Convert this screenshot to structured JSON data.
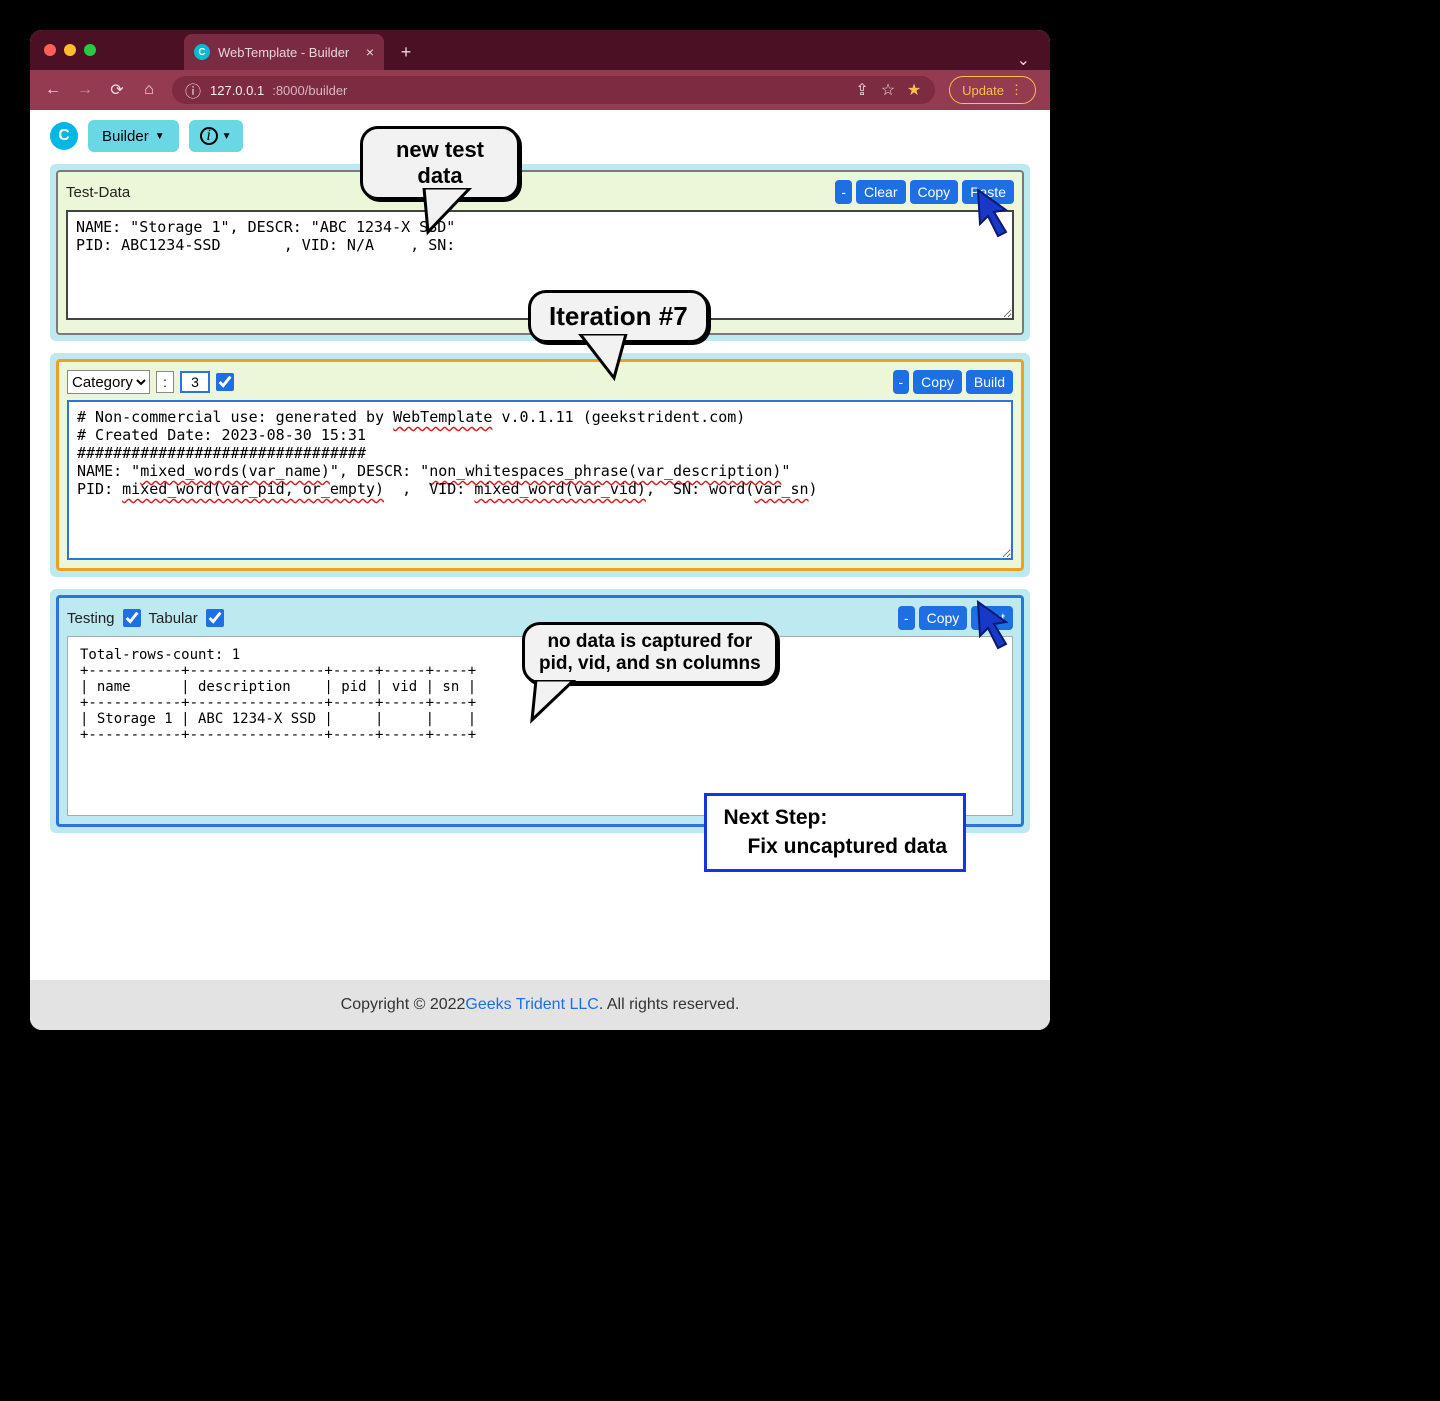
{
  "browser": {
    "tab_title": "WebTemplate - Builder",
    "url_host": "127.0.0.1",
    "url_port_path": ":8000/builder",
    "update_label": "Update"
  },
  "appbar": {
    "builder_label": "Builder",
    "info_icon": "i"
  },
  "testdata": {
    "title": "Test-Data",
    "btn_minus": "-",
    "btn_clear": "Clear",
    "btn_copy": "Copy",
    "btn_paste": "Paste",
    "content": "NAME: \"Storage 1\", DESCR: \"ABC 1234-X SSD\"\nPID: ABC1234-SSD       , VID: N/A    , SN:"
  },
  "template": {
    "select_label": "Category",
    "colon": ":",
    "num": "3",
    "btn_minus": "-",
    "btn_copy": "Copy",
    "btn_build": "Build",
    "content_pre": "# Non-commercial use: generated by ",
    "content_app": "WebTemplate",
    "content_ver": " v.0.1.11 (geekstrident.com)\n# Created Date: 2023-08-30 15:31\n################################\nNAME: \"",
    "content_mw1": "mixed_words(var_name)",
    "content_mid1": "\", DESCR: \"",
    "content_nw": "non_whitespaces_phrase(var_description)",
    "content_mid2": "\"\nPID: ",
    "content_mw2": "mixed_word(var_pid, or_empty)",
    "content_mid3": "  ,  VID: ",
    "content_mw3": "mixed_word(var_vid)",
    "content_mid4": ",  SN: word(",
    "content_vs": "var_sn",
    "content_end": ")"
  },
  "testing": {
    "title": "Testing",
    "tabular_label": "Tabular",
    "btn_minus": "-",
    "btn_copy": "Copy",
    "btn_test": "Test",
    "results": "Total-rows-count: 1\n+-----------+----------------+-----+-----+----+\n| name      | description    | pid | vid | sn |\n+-----------+----------------+-----+-----+----+\n| Storage 1 | ABC 1234-X SSD |     |     |    |\n+-----------+----------------+-----+-----+----+"
  },
  "callouts": {
    "newdata": "new test data",
    "iteration": "Iteration #7",
    "nocapture": "no data is captured for\npid, vid, and sn columns",
    "next_l1": "Next Step:",
    "next_l2": "Fix uncaptured data"
  },
  "footer": {
    "pre": "Copyright © 2022 ",
    "link": "Geeks Trident LLC",
    "post": ". All rights reserved."
  }
}
